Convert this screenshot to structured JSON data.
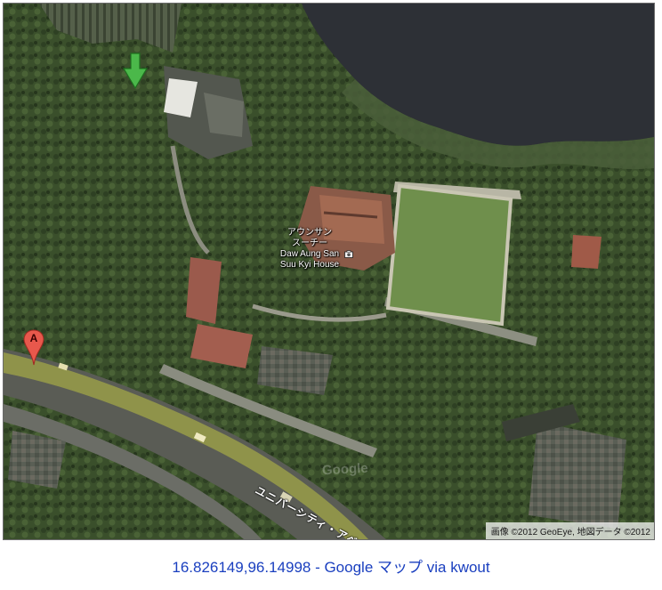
{
  "map": {
    "place_label_lines": [
      "アウンサン",
      "スーチー",
      "Daw Aung San",
      "Suu Kyi House"
    ],
    "road_label": "ユニバーシティ・アベ",
    "watermark": "Google",
    "copyright": "画像 ©2012 GeoEye, 地図データ ©2012",
    "marker_a_label": "A"
  },
  "caption": {
    "link_text": "16.826149,96.14998 - Google マップ",
    "via_text": "via",
    "kwout_text": "kwout"
  },
  "colors": {
    "water": "#2d3036",
    "vegetation": "#3f5a2e",
    "lawn": "#6f8f4c",
    "road_highlight": "#9a9a4a",
    "marker_red": "#e8584c",
    "marker_green": "#4bb84a",
    "caption_link": "#1a3fbf"
  }
}
